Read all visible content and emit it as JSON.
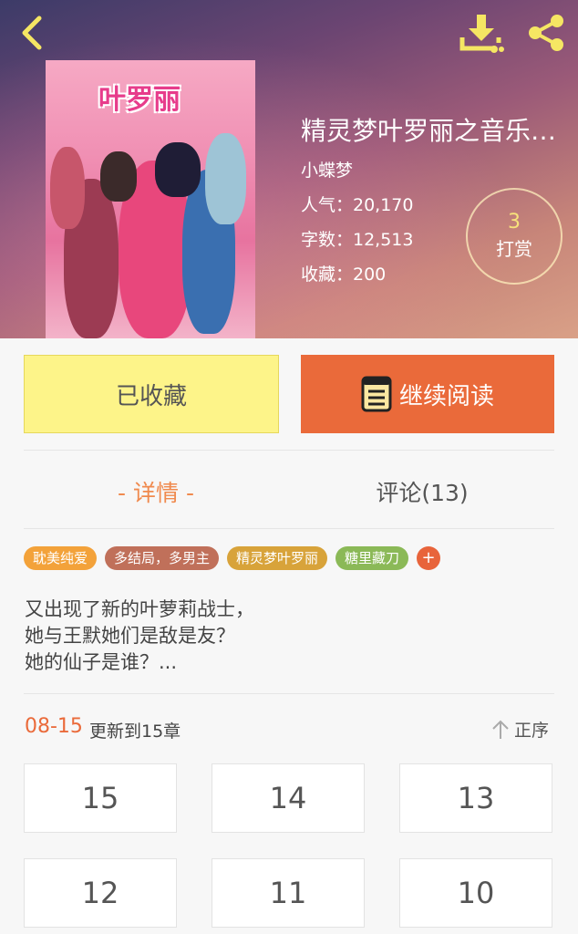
{
  "header": {
    "back_icon": "chevron-left-icon",
    "download_icon": "download-icon",
    "share_icon": "share-icon",
    "accent_color": "#f5e663"
  },
  "book": {
    "cover_title": "叶罗丽",
    "title": "精灵梦叶罗丽之音乐…",
    "author": "小蝶梦",
    "popularity": "人气：20,170",
    "word_count": "字数：12,513",
    "favorites": "收藏：200"
  },
  "tip": {
    "count": "3",
    "label": "打赏"
  },
  "actions": {
    "collected_label": "已收藏",
    "continue_label": "继续阅读",
    "continue_color": "#ea6a3a"
  },
  "tabs": {
    "detail": "- 详情 -",
    "comments": "评论(13)"
  },
  "tags": [
    {
      "label": "耽美纯爱",
      "color": "#f3a23a"
    },
    {
      "label": "多结局，多男主",
      "color": "#c0705a"
    },
    {
      "label": "精灵梦叶罗丽",
      "color": "#d8a33a"
    },
    {
      "label": "糖里藏刀",
      "color": "#8bb957"
    }
  ],
  "tag_more": "+",
  "description": [
    "又出现了新的叶萝莉战士，",
    "她与王默她们是敌是友？",
    "她的仙子是谁？..."
  ],
  "update": {
    "date": "08-15",
    "text": "更新到15章"
  },
  "sort_label": "正序",
  "chapters": [
    "15",
    "14",
    "13",
    "12",
    "11",
    "10"
  ]
}
